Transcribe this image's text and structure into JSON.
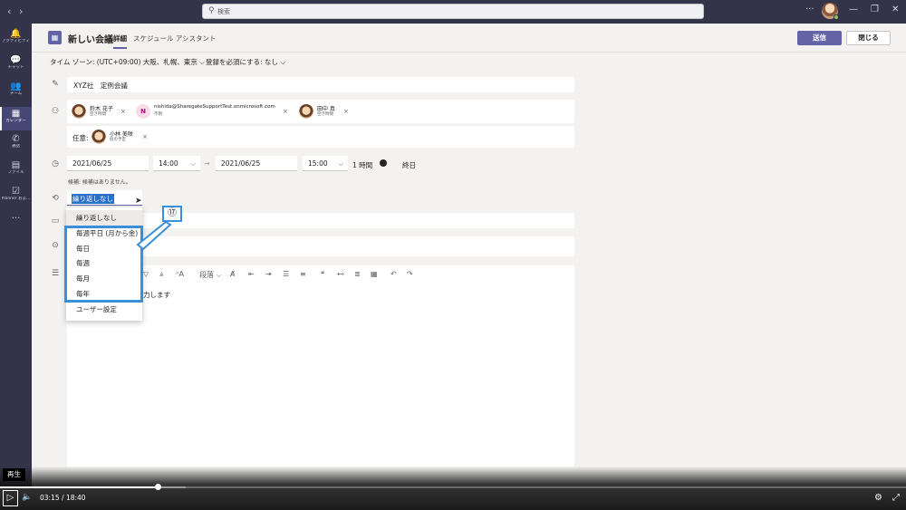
{
  "titlebar": {
    "search_placeholder": "検索",
    "more": "···",
    "minimize": "—",
    "maximize": "❐",
    "close": "✕"
  },
  "rail": [
    {
      "icon": "bell-icon",
      "glyph": "🔔",
      "label": "アクティビティ"
    },
    {
      "icon": "chat-icon",
      "glyph": "💬",
      "label": "チャット"
    },
    {
      "icon": "teams-icon",
      "glyph": "👥",
      "label": "チーム"
    },
    {
      "icon": "calendar-icon",
      "glyph": "▦",
      "label": "カレンダー",
      "active": true
    },
    {
      "icon": "phone-icon",
      "glyph": "✆",
      "label": "通話"
    },
    {
      "icon": "files-icon",
      "glyph": "▤",
      "label": "ファイル"
    },
    {
      "icon": "planner-icon",
      "glyph": "☑",
      "label": "Planner およ..."
    },
    {
      "icon": "more-icon",
      "glyph": "···",
      "label": ""
    }
  ],
  "header": {
    "title": "新しい会議",
    "tab_detail": "詳細",
    "tab_assistant": "スケジュール アシスタント",
    "send": "送信",
    "close": "閉じる"
  },
  "options": {
    "timezone": "タイム ゾーン: (UTC+09:00) 大阪、札幌、東京",
    "registration": "登録を必須にする: なし"
  },
  "meeting": {
    "title": "XYZ社　定例会議",
    "required": [
      {
        "name": "鈴木 花子",
        "status": "空き時間"
      },
      {
        "name": "nishida@SharegateSupportTest.onmicrosoft.com",
        "status": "不明",
        "initial": "N"
      },
      {
        "name": "田中 真",
        "status": "空き時間"
      }
    ],
    "optional_label": "任意:",
    "optional": [
      {
        "name": "小林 美咲",
        "status": "仮の予定"
      }
    ],
    "start_date": "2021/06/25",
    "start_time": "14:00",
    "end_date": "2021/06/25",
    "end_time": "15:00",
    "duration": "1 時間",
    "all_day": "終日",
    "suggestion": "候補: 候補はありません。",
    "repeat_value": "繰り返しなし"
  },
  "dropdown": {
    "items": [
      "繰り返しなし",
      "毎週平日 (月から金)",
      "毎日",
      "毎週",
      "毎月",
      "毎年",
      "ユーザー設定"
    ],
    "selected_index": 0
  },
  "annotation": {
    "callout": "⑰",
    "color": "#3a90d8"
  },
  "editor": {
    "paragraph": "段落",
    "body_placeholder_fragment": "力します"
  },
  "player": {
    "tooltip": "再生",
    "current": "03:15",
    "separator": "/",
    "total": "18:40",
    "progress_fraction": 0.174
  },
  "colors": {
    "accent": "#6264a7",
    "rail": "#33344a"
  }
}
